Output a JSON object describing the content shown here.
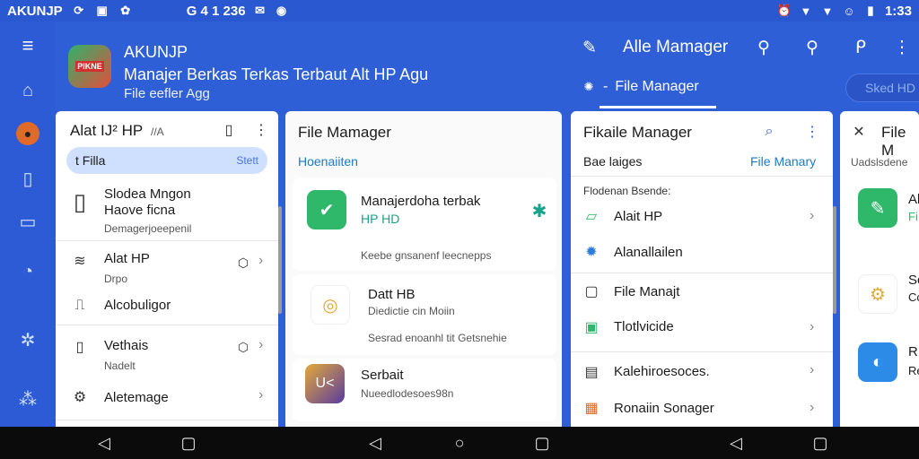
{
  "status": {
    "carrier": "AKUNJP",
    "clock": "G 4 1 236",
    "time": "1:33",
    "left_icons": [
      "sync-icon",
      "image-icon",
      "settings-icon"
    ],
    "right_icons": [
      "alarm-icon",
      "wifi-icon",
      "wifi-icon",
      "face-icon",
      "battery-icon"
    ]
  },
  "rail": {
    "items": [
      "menu-icon",
      "home-icon",
      "record-icon",
      "split-icon",
      "folder-icon",
      "clock-icon",
      "gear-icon",
      "apps-icon"
    ]
  },
  "header": {
    "app_name": "AKUNJP",
    "subtitle": "Manajer Berkas Terkas Terbaut Alt HP Agu",
    "subtitle2": "File eefler Agg",
    "logo_text": "PIKNE",
    "title": "Alle Mamager",
    "tab_label": "File Manager",
    "tab_prefix": "-",
    "pill": "Sked HD"
  },
  "panel1": {
    "title": "Alat IJ² HP",
    "title_extra": "//A",
    "search_text": "t Filla",
    "search_action": "Stett",
    "device": {
      "line1": "Slodea Mngon",
      "line2": "Haove ficna",
      "line3": "Demagerjoeepenil"
    },
    "items": [
      {
        "label": "Alat HP",
        "sub": "Drpo"
      },
      {
        "label": "Alcobuligor",
        "sub": ""
      },
      {
        "label": "Vethais",
        "sub": "Nadelt"
      },
      {
        "label": "Aletemage",
        "sub": ""
      }
    ]
  },
  "panel2": {
    "title": "File Mamager",
    "link": "Hoenaiiten",
    "card1": {
      "title": "Manajerdoha terbak",
      "sub": "HP HD",
      "desc": "Keebe gnsanenf leecnepps"
    },
    "card2": {
      "title": "Datt HB",
      "sub": "Diedictie cin Moiin",
      "desc": "Sesrad enoanhl tit Getsnehie"
    },
    "card3": {
      "title": "Serbait",
      "sub": "Nueedlodesoes98n",
      "tile_text": "U<"
    }
  },
  "panel3": {
    "title": "Fikaile Manager",
    "left_label": "Bae laiges",
    "link": "File Manary",
    "section": "Flodenan Bsende:",
    "items": [
      {
        "label": "Alait HP"
      },
      {
        "label": "Alanallailen"
      },
      {
        "label": "File Manajt"
      },
      {
        "label": "Tlotlvicide"
      },
      {
        "label": "Kalehiroesoces."
      },
      {
        "label": "Ronaiin Sonager"
      }
    ]
  },
  "panel4": {
    "title": "File M",
    "sub": "Uadslsdene",
    "letters": [
      "Al",
      "Fi",
      "Sc",
      "Cc",
      "R",
      "Re"
    ]
  },
  "colors": {
    "primary": "#2f5fd7",
    "accent": "#1c79c7",
    "teal": "#16a38a"
  }
}
